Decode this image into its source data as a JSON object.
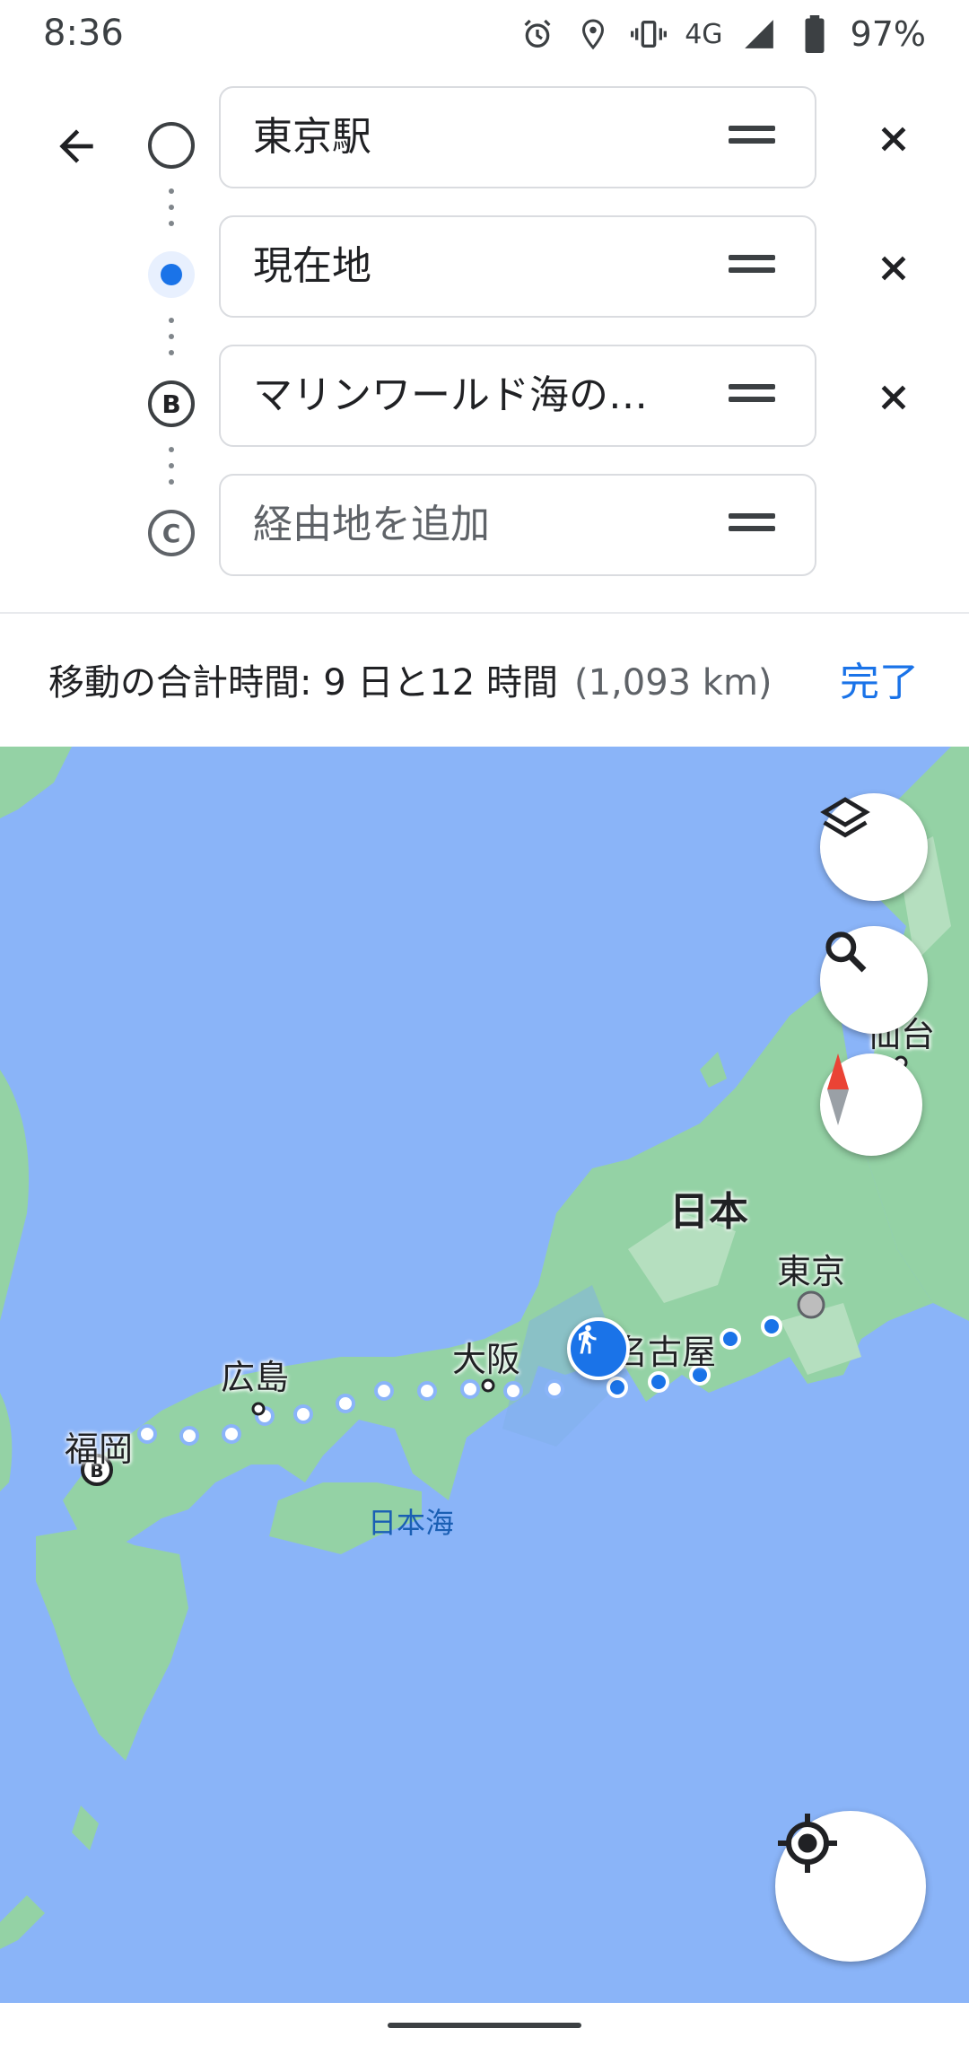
{
  "status_bar": {
    "time": "8:36",
    "network": "4G",
    "battery": "97%",
    "icons": [
      "alarm-icon",
      "location-icon",
      "vibrate-icon",
      "signal-icon",
      "battery-icon"
    ]
  },
  "directions": {
    "back_icon": "arrow-back-icon",
    "waypoints": [
      {
        "marker": "circle-hollow",
        "value": "東京駅"
      },
      {
        "marker": "current-location-dot",
        "value": "現在地"
      },
      {
        "marker": "B",
        "value": "マリンワールド海の…"
      },
      {
        "marker": "C",
        "placeholder": "経由地を追加"
      }
    ],
    "marker_b": "B",
    "marker_c": "C"
  },
  "summary": {
    "label": "移動の合計時間: 9 日と12 時間",
    "distance": "(1,093 km)",
    "done": "完了"
  },
  "map": {
    "sea_label": "日本海",
    "country_label": "日本",
    "cities": [
      "東京",
      "名古屋",
      "大阪",
      "広島",
      "福岡",
      "仙台"
    ],
    "destination_marker": "B",
    "mode_icon": "walk-icon",
    "route_color": "#1a73e8",
    "water_color": "#8ab4f8",
    "land_color": "#94d2a5"
  }
}
